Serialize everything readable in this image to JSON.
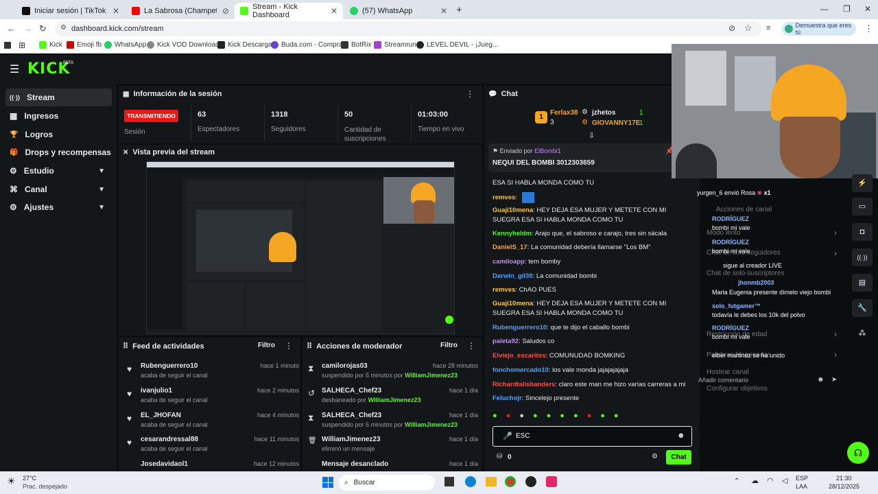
{
  "browser": {
    "tabs": [
      {
        "title": "Iniciar sesión | TikTok",
        "color": "#111"
      },
      {
        "title": "La Sabrosa (Champeta Africana",
        "color": "#f00"
      },
      {
        "title": "Stream - Kick Dashboard",
        "color": "#53fc18"
      },
      {
        "title": "(57) WhatsApp",
        "color": "#25d366"
      }
    ],
    "url": "dashboard.kick.com/stream",
    "profile_label": "Demuestra que eres tú",
    "bookmarks": [
      "Kick",
      "Emoji fb",
      "WhatsApp",
      "Kick VOD Download...",
      "Kick Descargar",
      "Buda.com - Compra...",
      "BotRix",
      "Streamrun",
      "LEVEL DEVIL - ¡Jueg..."
    ]
  },
  "kick": {
    "logo": "KICK",
    "beta": "BETA",
    "nav": [
      {
        "label": "Stream",
        "icon": "((·))"
      },
      {
        "label": "Ingresos",
        "icon": "▦"
      },
      {
        "label": "Logros",
        "icon": "🏆"
      },
      {
        "label": "Drops y recompensas",
        "icon": "🎁"
      },
      {
        "label": "Estudio",
        "icon": "⚙"
      },
      {
        "label": "Canal",
        "icon": "⌘"
      },
      {
        "label": "Ajustes",
        "icon": "⚙"
      }
    ],
    "session": {
      "title": "Información de la sesión",
      "live_badge": "TRANSMITIENDO",
      "session_label": "Sesión",
      "stats": [
        {
          "value": "63",
          "label": "Espectadores"
        },
        {
          "value": "1318",
          "label": "Seguidores"
        },
        {
          "value": "50",
          "label": "Cantidad de suscripciones"
        },
        {
          "value": "01:03:00",
          "label": "Tiempo en vivo"
        }
      ]
    },
    "preview_title": "Vista previa del stream",
    "feed": {
      "title": "Feed de actividades",
      "filter": "Filtro",
      "rows": [
        {
          "name": "Rubenguerrero10",
          "sub": "acaba de seguir el canal",
          "time": "hace 1 minuto"
        },
        {
          "name": "ivanjulio1",
          "sub": "acaba de seguir el canal",
          "time": "hace 2 minutos"
        },
        {
          "name": "EL_JHOFAN",
          "sub": "acaba de seguir el canal",
          "time": "hace 4 minutos"
        },
        {
          "name": "cesarandressal88",
          "sub": "acaba de seguir el canal",
          "time": "hace 11 minutos"
        },
        {
          "name": "Josedavidaol1",
          "sub": "",
          "time": "hace 12 minutos"
        }
      ]
    },
    "mod": {
      "title": "Acciones de moderador",
      "filter": "Filtro",
      "rows": [
        {
          "icon": "⧗",
          "name": "camilorojas03",
          "sub": "suspendido por 5 minutos por",
          "by": "WilliamJimenez23",
          "time": "hace 28 minutos"
        },
        {
          "icon": "↺",
          "name": "SALHECA_Chef23",
          "sub": "desbaneado por",
          "by": "WilliamJimenez23",
          "time": "hace 1 día"
        },
        {
          "icon": "⧗",
          "name": "SALHECA_Chef23",
          "sub": "suspendido por 5 minutos por",
          "by": "WilliamJimenez23",
          "time": "hace 1 día"
        },
        {
          "icon": "🗑",
          "name": "WilliamJimenez23",
          "sub": "eliminó un mensaje",
          "by": "",
          "time": "hace 1 día"
        },
        {
          "icon": "📌",
          "name": "Mensaje desanclado",
          "sub": "",
          "by": "",
          "time": "hace 1 día"
        }
      ]
    },
    "chat": {
      "title": "Chat",
      "gifters": [
        {
          "rank": "1",
          "name": "Ferlax38",
          "count": "3"
        },
        {
          "name": "jzhetos",
          "count": "1"
        },
        {
          "name": "GIOVANNY17E",
          "count": "1"
        }
      ],
      "pinned_by_label": "Enviado por",
      "pinned_by": "ElBombi1",
      "pinned_text": "NEQUI DEL BOMBI 3012303659",
      "messages": [
        {
          "user": "",
          "text": "ESA SI HABLA MONDA COMO TU",
          "color": "#e8eaed"
        },
        {
          "user": "remves",
          "text": "",
          "color": "#f7c948"
        },
        {
          "user": "Guaji10mena",
          "text": "HEY DEJA ESA MUJER Y METETE CON MI SUEGRA ESA SI HABLA MONDA COMO TU",
          "color": "#f7c948"
        },
        {
          "user": "Kennyheldm",
          "text": "Arajo que, el sabroso e carajo, tres sin sácala",
          "color": "#53fc18"
        },
        {
          "user": "DanielS_17",
          "text": "La comunidad debería llamarse \"Los BM\"",
          "color": "#f7a948"
        },
        {
          "user": "camiloapp",
          "text": "tem bomby",
          "color": "#c58af9"
        },
        {
          "user": "Darwin_gil30",
          "text": "La comunidad bombi",
          "color": "#4da3ff"
        },
        {
          "user": "remves",
          "text": "ChAO PUES",
          "color": "#f7c948"
        },
        {
          "user": "Guaji10mena",
          "text": "HEY DEJA ESA MUJER Y METETE CON MI SUEGRA ESA SI HABLA MONDA COMO TU",
          "color": "#f7c948"
        },
        {
          "user": "Rubenguerrero10",
          "text": "que te dijo el caballo bombi",
          "color": "#4da3ff"
        },
        {
          "user": "paleta92",
          "text": "Saludos co",
          "color": "#c58af9"
        },
        {
          "user": "Elviejo_escaritos",
          "text": "COMUNUDAD BOMKING",
          "color": "#ff4d4d"
        },
        {
          "user": "fonchomercado10",
          "text": "los vale monda jajajajajaja",
          "color": "#4da3ff"
        },
        {
          "user": "Richardtalisbanders",
          "text": "claro este man me hizo varías carreras a mi",
          "color": "#ff4d4d"
        },
        {
          "user": "Feluchojr",
          "text": "Sincelejo presente",
          "color": "#4da3ff"
        }
      ],
      "input_value": "ESC",
      "points": "0",
      "send_label": "Chat"
    },
    "overlay": {
      "gift_user": "yurgen_6",
      "gift_text": "envió Rosa",
      "gift_count": "x1",
      "menu": [
        "Acciones de canal",
        "Modo lento",
        "Chat de solo seguidores",
        "Chat de solo-suscriptores",
        "Restricción de edad",
        "Palabras bloqueadas",
        "Hostear canal",
        "Configurar objetivos"
      ],
      "msgs": [
        {
          "user": "RODRÍGUEZ",
          "text": "bombi mi vale"
        },
        {
          "user": "RODRÍGUEZ",
          "text": "bombi mi vale"
        },
        {
          "user": "",
          "text": "sigue al creador LIVE"
        },
        {
          "user": "jhonmb2003",
          "text": "Maria Eugenia presente dímelo viejo bombi"
        },
        {
          "user": "solo_futgamer™",
          "text": "todavía le debes los 10k del polvo"
        },
        {
          "user": "RODRÍGUEZ",
          "text": "bombi mi vale"
        },
        {
          "user": "elber martinez",
          "text": "se ha unido"
        }
      ],
      "comment_placeholder": "Añadir comentario"
    }
  },
  "taskbar": {
    "weather_temp": "27°C",
    "weather_desc": "Prac. despejado",
    "search": "Buscar",
    "lang": "ESP",
    "lang2": "LAA",
    "time": "21:30",
    "date": "28/12/2025"
  },
  "colors": {
    "kick_green": "#53fc18",
    "live_red": "#e91916",
    "panel": "#141719",
    "bg": "#0b0e0f"
  }
}
